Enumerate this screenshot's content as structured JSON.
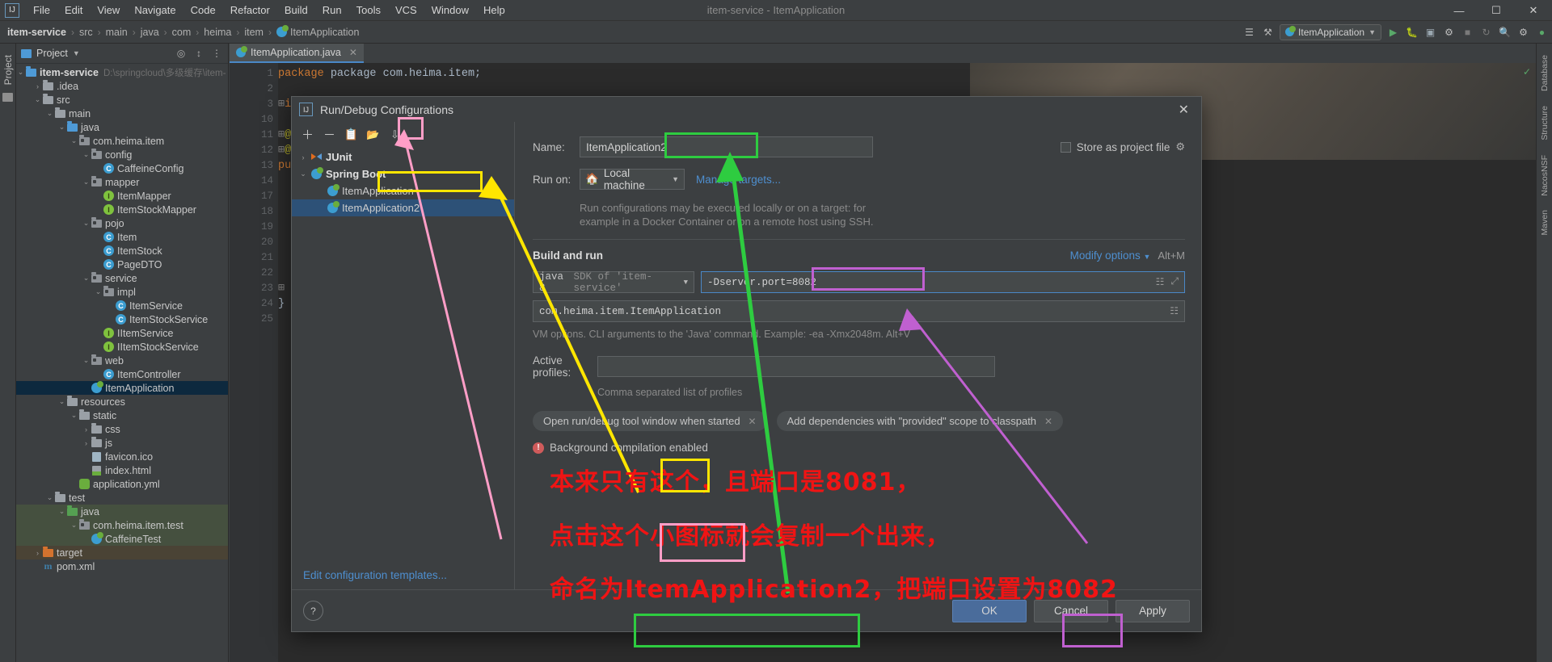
{
  "window": {
    "title": "item-service - ItemApplication"
  },
  "menubar": {
    "items": [
      "File",
      "Edit",
      "View",
      "Navigate",
      "Code",
      "Refactor",
      "Build",
      "Run",
      "Tools",
      "VCS",
      "Window",
      "Help"
    ]
  },
  "winbuttons": {
    "minimize": "—",
    "maximize": "☐",
    "close": "✕"
  },
  "breadcrumb": {
    "items": [
      "item-service",
      "src",
      "main",
      "java",
      "com",
      "heima",
      "item",
      "ItemApplication"
    ],
    "separator": "›"
  },
  "toolbar": {
    "run_config": "ItemApplication",
    "icons": [
      "profiler-icon",
      "hammer-icon",
      "run-icon",
      "debug-icon",
      "coverage-icon",
      "profile-icon",
      "stop-icon",
      "update-icon",
      "search-icon",
      "settings-icon",
      "account-icon"
    ]
  },
  "left_strip": {
    "tab": "Project"
  },
  "right_strip": {
    "tabs": [
      "Database",
      "Structure",
      "NacosNSF",
      "Maven"
    ]
  },
  "project_panel": {
    "header": "Project",
    "tree": [
      {
        "depth": 0,
        "label": "item-service",
        "path": "D:\\springcloud\\多级缓存\\item-",
        "icon": "module-folder",
        "arrow": "v",
        "bold": true
      },
      {
        "depth": 1,
        "label": ".idea",
        "icon": "folder",
        "arrow": ">"
      },
      {
        "depth": 1,
        "label": "src",
        "icon": "folder",
        "arrow": "v"
      },
      {
        "depth": 2,
        "label": "main",
        "icon": "folder",
        "arrow": "v"
      },
      {
        "depth": 3,
        "label": "java",
        "icon": "folder-blue",
        "arrow": "v"
      },
      {
        "depth": 4,
        "label": "com.heima.item",
        "icon": "package",
        "arrow": "v"
      },
      {
        "depth": 5,
        "label": "config",
        "icon": "package",
        "arrow": "v"
      },
      {
        "depth": 6,
        "label": "CaffeineConfig",
        "icon": "class"
      },
      {
        "depth": 5,
        "label": "mapper",
        "icon": "package",
        "arrow": "v"
      },
      {
        "depth": 6,
        "label": "ItemMapper",
        "icon": "interface"
      },
      {
        "depth": 6,
        "label": "ItemStockMapper",
        "icon": "interface"
      },
      {
        "depth": 5,
        "label": "pojo",
        "icon": "package",
        "arrow": "v"
      },
      {
        "depth": 6,
        "label": "Item",
        "icon": "class"
      },
      {
        "depth": 6,
        "label": "ItemStock",
        "icon": "class"
      },
      {
        "depth": 6,
        "label": "PageDTO",
        "icon": "class"
      },
      {
        "depth": 5,
        "label": "service",
        "icon": "package",
        "arrow": "v"
      },
      {
        "depth": 6,
        "label": "impl",
        "icon": "package",
        "arrow": "v"
      },
      {
        "depth": 7,
        "label": "ItemService",
        "icon": "class"
      },
      {
        "depth": 7,
        "label": "ItemStockService",
        "icon": "class"
      },
      {
        "depth": 6,
        "label": "IItemService",
        "icon": "interface"
      },
      {
        "depth": 6,
        "label": "IItemStockService",
        "icon": "interface"
      },
      {
        "depth": 5,
        "label": "web",
        "icon": "package",
        "arrow": "v"
      },
      {
        "depth": 6,
        "label": "ItemController",
        "icon": "class"
      },
      {
        "depth": 5,
        "label": "ItemApplication",
        "icon": "spring-class",
        "selected": true
      },
      {
        "depth": 3,
        "label": "resources",
        "icon": "folder-resources",
        "arrow": "v"
      },
      {
        "depth": 4,
        "label": "static",
        "icon": "folder",
        "arrow": "v"
      },
      {
        "depth": 5,
        "label": "css",
        "icon": "folder",
        "arrow": ">"
      },
      {
        "depth": 5,
        "label": "js",
        "icon": "folder",
        "arrow": ">"
      },
      {
        "depth": 5,
        "label": "favicon.ico",
        "icon": "ico-file"
      },
      {
        "depth": 5,
        "label": "index.html",
        "icon": "html-file"
      },
      {
        "depth": 4,
        "label": "application.yml",
        "icon": "yml-file"
      },
      {
        "depth": 2,
        "label": "test",
        "icon": "folder",
        "arrow": "v"
      },
      {
        "depth": 3,
        "label": "java",
        "icon": "folder-green",
        "arrow": "v",
        "bg": "green"
      },
      {
        "depth": 4,
        "label": "com.heima.item.test",
        "icon": "package",
        "arrow": "v",
        "bg": "green"
      },
      {
        "depth": 5,
        "label": "CaffeineTest",
        "icon": "spring-class",
        "bg": "green"
      },
      {
        "depth": 1,
        "label": "target",
        "icon": "folder-orange",
        "arrow": ">",
        "bg": "brown"
      },
      {
        "depth": 1,
        "label": "pom.xml",
        "icon": "maven-file"
      }
    ]
  },
  "editor": {
    "tab": "ItemApplication.java",
    "lines": [
      "1",
      "2",
      "3",
      "10",
      "11",
      "12",
      "13",
      "14",
      "17",
      "18",
      "19",
      "20",
      "21",
      "22",
      "23",
      "24",
      "25"
    ],
    "code_first_line": "package com.heima.item;",
    "code_tokens": [
      "package",
      "com.heima.item;",
      "in",
      "@M",
      "@S",
      "pu",
      "}"
    ]
  },
  "dialog": {
    "title": "Run/Debug Configurations",
    "close_glyph": "✕",
    "toolbar_icons": [
      "add-icon",
      "remove-icon",
      "copy-configuration-icon",
      "save-configuration-icon",
      "sort-icon"
    ],
    "config_tree": [
      {
        "label": "JUnit",
        "icon": "junit-icon",
        "arrow": ">",
        "bold": true
      },
      {
        "label": "Spring Boot",
        "icon": "spring-icon",
        "arrow": "v",
        "bold": true
      },
      {
        "label": "ItemApplication",
        "icon": "spring-run-icon",
        "indent": true
      },
      {
        "label": "ItemApplication2",
        "icon": "spring-run-icon",
        "indent": true,
        "selected": true
      }
    ],
    "name_label": "Name:",
    "name_value": "ItemApplication2",
    "store_as_project_file": "Store as project file",
    "run_on_label": "Run on:",
    "run_on_value": "Local machine",
    "manage_targets": "Manage targets...",
    "run_hint_line1": "Run configurations may be executed locally or on a target: for",
    "run_hint_line2": "example in a Docker Container or on a remote host using SSH.",
    "build_and_run": "Build and run",
    "modify_options": "Modify options",
    "modify_shortcut": "Alt+M",
    "sdk_value": "java 8",
    "sdk_dim": "SDK of 'item-service'",
    "vm_options_value": "-Dserver.port=8082",
    "main_class_value": "com.heima.item.ItemApplication",
    "vm_hint": "VM options. CLI arguments to the 'Java' command. Example: -ea -Xmx2048m. Alt+V",
    "active_profiles_label": "Active profiles:",
    "active_profiles_value": "",
    "profiles_hint": "Comma separated list of profiles",
    "chips": [
      "Open run/debug tool window when started",
      "Add dependencies with \"provided\" scope to classpath"
    ],
    "warning": "Background compilation enabled",
    "edit_templates": "Edit configuration templates...",
    "help_glyph": "?",
    "buttons": {
      "ok": "OK",
      "cancel": "Cancel",
      "apply": "Apply"
    }
  },
  "annotations": {
    "color": "#f01414",
    "lines": [
      {
        "text": "本来只有这个，且端口是8081，"
      },
      {
        "text": "点击这个小图标就会复制一个出来，"
      },
      {
        "text": "命名为ItemApplication2，把端口设置为8082"
      }
    ],
    "highlight_boxes": [
      {
        "name": "yellow-box-zhege",
        "color": "#ffe600"
      },
      {
        "name": "pink-box-xiaotubiao",
        "color": "#ff9ec7"
      },
      {
        "name": "green-box-itemapplication2",
        "color": "#2ecc40"
      },
      {
        "name": "purple-box-8082",
        "color": "#c060d0"
      }
    ],
    "arrows": [
      {
        "name": "pink-arrow-copy-icon",
        "color": "#ff9ec7"
      },
      {
        "name": "yellow-arrow-itemapplication",
        "color": "#ffe600"
      },
      {
        "name": "green-arrow-name-field",
        "color": "#2ecc40"
      },
      {
        "name": "purple-arrow-vm-options",
        "color": "#c060d0"
      }
    ]
  }
}
